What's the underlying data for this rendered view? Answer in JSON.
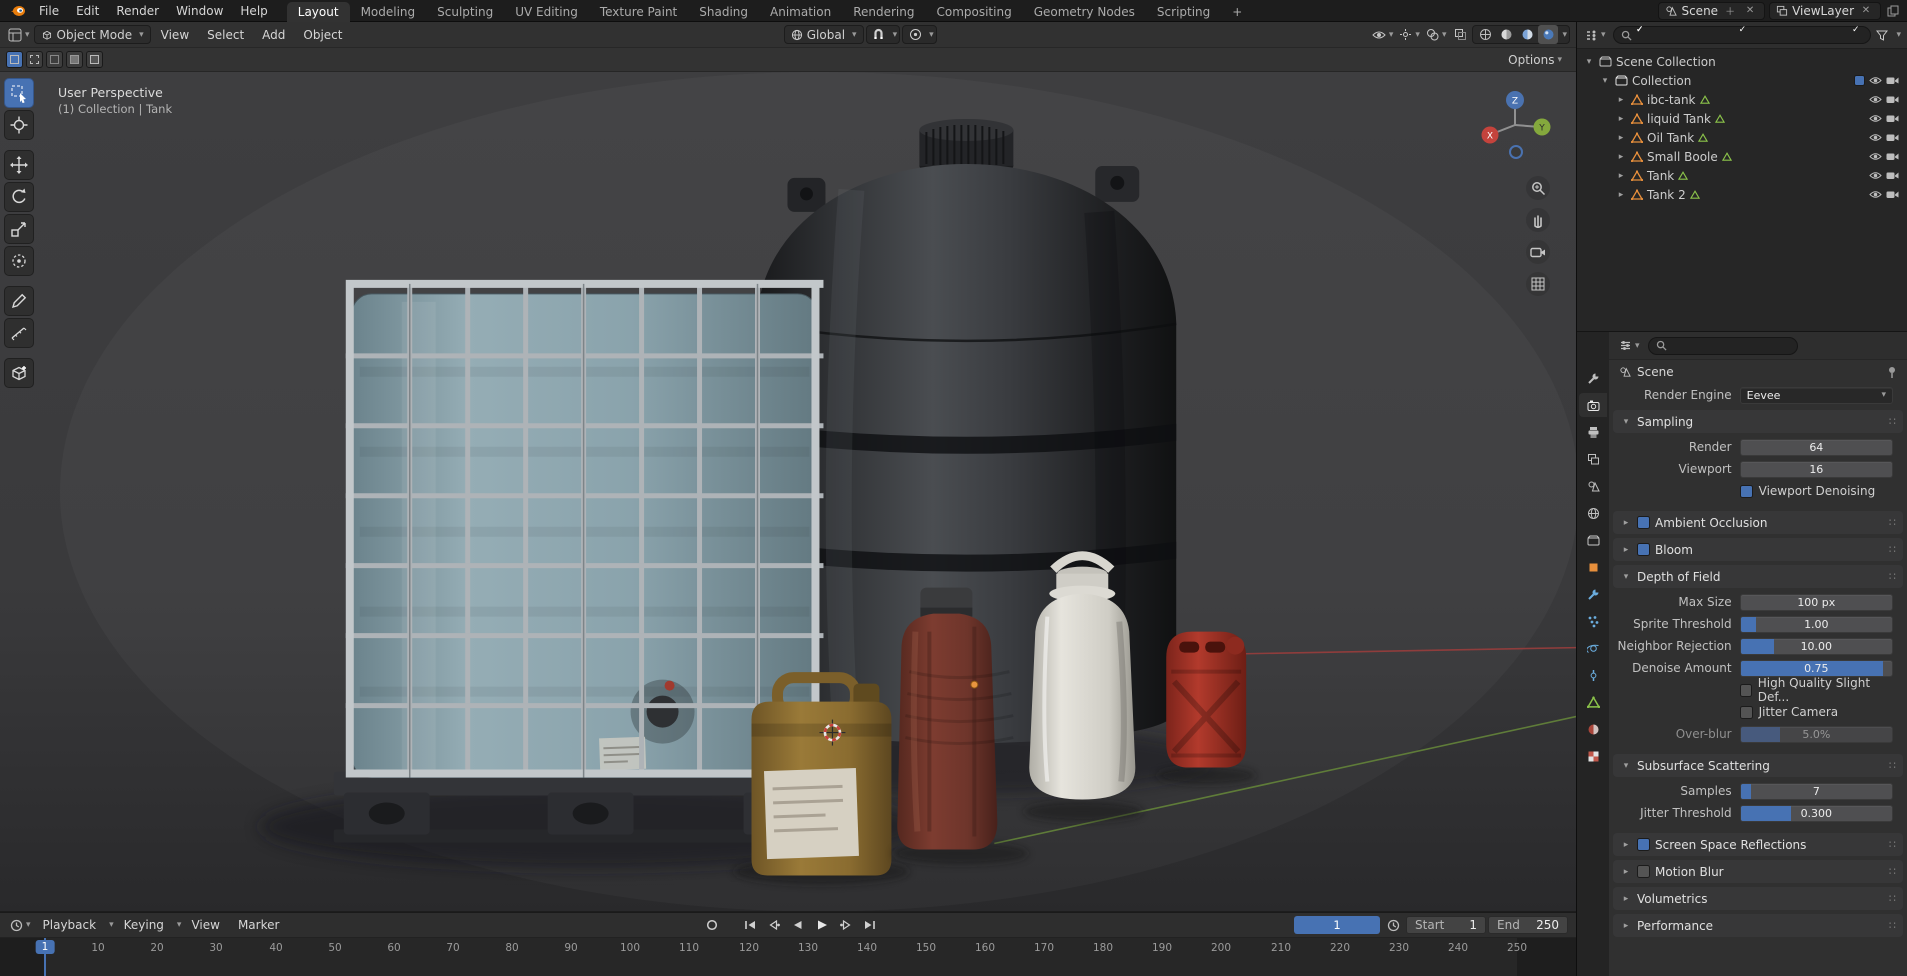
{
  "topbar": {
    "menus": [
      "File",
      "Edit",
      "Render",
      "Window",
      "Help"
    ],
    "workspaces": [
      "Layout",
      "Modeling",
      "Sculpting",
      "UV Editing",
      "Texture Paint",
      "Shading",
      "Animation",
      "Rendering",
      "Compositing",
      "Geometry Nodes",
      "Scripting"
    ],
    "add_workspace": "+",
    "scene": "Scene",
    "viewlayer": "ViewLayer"
  },
  "viewport": {
    "mode": "Object Mode",
    "menus": [
      "View",
      "Select",
      "Add",
      "Object"
    ],
    "orientation": "Global",
    "options": "Options",
    "overlay_line1": "User Perspective",
    "overlay_line2": "(1) Collection | Tank",
    "axis": {
      "x": "X",
      "y": "Y",
      "z": "Z"
    }
  },
  "outliner": {
    "scene_collection": "Scene Collection",
    "collection": "Collection",
    "objects": [
      "ibc-tank",
      "liquid Tank",
      "Oil Tank",
      "Small Boole",
      "Tank",
      "Tank 2"
    ]
  },
  "properties": {
    "breadcrumb": "Scene",
    "render_engine_label": "Render Engine",
    "render_engine": "Eevee",
    "panels": {
      "sampling": "Sampling",
      "ambient_occlusion": "Ambient Occlusion",
      "bloom": "Bloom",
      "depth_of_field": "Depth of Field",
      "subsurface_scattering": "Subsurface Scattering",
      "screen_space_reflections": "Screen Space Reflections",
      "motion_blur": "Motion Blur",
      "volumetrics": "Volumetrics",
      "performance": "Performance"
    },
    "sampling": {
      "render_label": "Render",
      "render": "64",
      "viewport_label": "Viewport",
      "viewport": "16",
      "denoising": "Viewport Denoising"
    },
    "dof": {
      "max_size_label": "Max Size",
      "max_size": "100 px",
      "sprite_label": "Sprite Threshold",
      "sprite": "1.00",
      "neighbor_label": "Neighbor Rejection",
      "neighbor": "10.00",
      "denoise_label": "Denoise Amount",
      "denoise": "0.75",
      "hq_label": "High Quality Slight Def...",
      "jitter_label": "Jitter Camera",
      "overblur_label": "Over-blur",
      "overblur": "5.0%"
    },
    "sss": {
      "samples_label": "Samples",
      "samples": "7",
      "jitter_label": "Jitter Threshold",
      "jitter": "0.300"
    }
  },
  "timeline": {
    "menus": [
      "Playback",
      "Keying",
      "View",
      "Marker"
    ],
    "current_frame": "1",
    "start_label": "Start",
    "start": "1",
    "end_label": "End",
    "end": "250",
    "ticks": [
      "0",
      "10",
      "20",
      "30",
      "40",
      "50",
      "60",
      "70",
      "80",
      "90",
      "100",
      "110",
      "120",
      "130",
      "140",
      "150",
      "160",
      "170",
      "180",
      "190",
      "200",
      "210",
      "220",
      "230",
      "240",
      "250"
    ]
  },
  "colors": {
    "accent": "#4772b3",
    "object_orange": "#e78f3c",
    "data_green": "#8bc34a"
  }
}
